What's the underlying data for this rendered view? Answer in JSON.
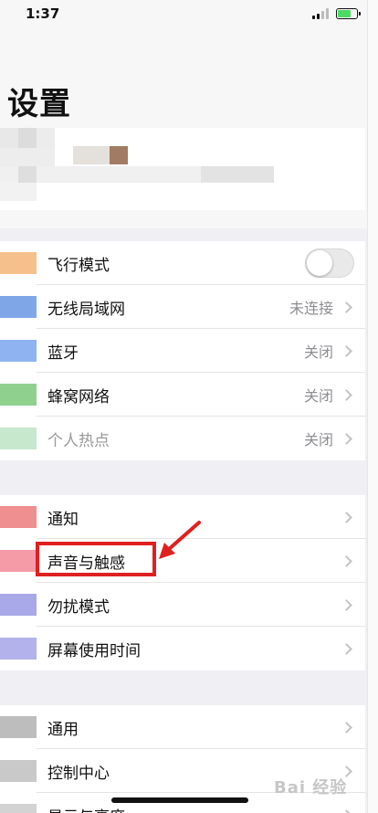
{
  "status_bar": {
    "time": "1:37",
    "signal_icon": "cellular-signal-icon",
    "battery_icon": "battery-charging-icon"
  },
  "title": "设置",
  "groups": [
    {
      "rows": [
        {
          "label": "飞行模式",
          "control": "toggle",
          "toggle_on": false
        },
        {
          "label": "无线局域网",
          "value": "未连接"
        },
        {
          "label": "蓝牙",
          "value": "关闭"
        },
        {
          "label": "蜂窝网络",
          "value": "关闭"
        },
        {
          "label": "个人热点",
          "value": "关闭",
          "dimmed": true
        }
      ],
      "icon_colors": [
        "#f6c08d",
        "#7fa7e8",
        "#8fb3f0",
        "#8fd08f",
        "#c8e8cd"
      ]
    },
    {
      "rows": [
        {
          "label": "通知"
        },
        {
          "label": "声音与触感",
          "highlighted": true
        },
        {
          "label": "勿扰模式"
        },
        {
          "label": "屏幕使用时间"
        }
      ],
      "icon_colors": [
        "#f08f8f",
        "#f49ba7",
        "#a9a8e8",
        "#b3b2ea"
      ]
    },
    {
      "rows": [
        {
          "label": "通用"
        },
        {
          "label": "控制中心"
        },
        {
          "label": "显示与亮度"
        }
      ],
      "icon_colors": [
        "#bdbdbd",
        "#c9c9c9",
        "#d3d3d3"
      ]
    }
  ],
  "colors": {
    "annotation_red": "#e02020",
    "chevron": "#c4c4c7",
    "secondary_text": "#8e8e93"
  },
  "watermark": "Bai 经验"
}
